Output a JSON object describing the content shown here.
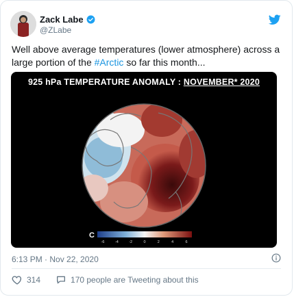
{
  "author": {
    "name": "Zack Labe",
    "handle": "@ZLabe"
  },
  "tweet": {
    "text_before": "Well above average temperatures (lower atmosphere) across a large portion of the ",
    "hashtag": "#Arctic",
    "text_after": " so far this month..."
  },
  "media": {
    "title_prefix": "925 hPa TEMPERATURE ANOMALY : ",
    "title_month": "NOVEMBER* 2020",
    "colorbar_unit": "C",
    "colorbar_ticks": [
      "-6",
      "-4",
      "-2",
      "0",
      "2",
      "4",
      "6"
    ],
    "colors": {
      "cold": "#2b6bb0",
      "warm": "#8c1d1d",
      "neutral": "#f4f4f4"
    }
  },
  "footer": {
    "timestamp": "6:13 PM · Nov 22, 2020",
    "likes": "314",
    "retweet_text": "170 people are Tweeting about this"
  }
}
